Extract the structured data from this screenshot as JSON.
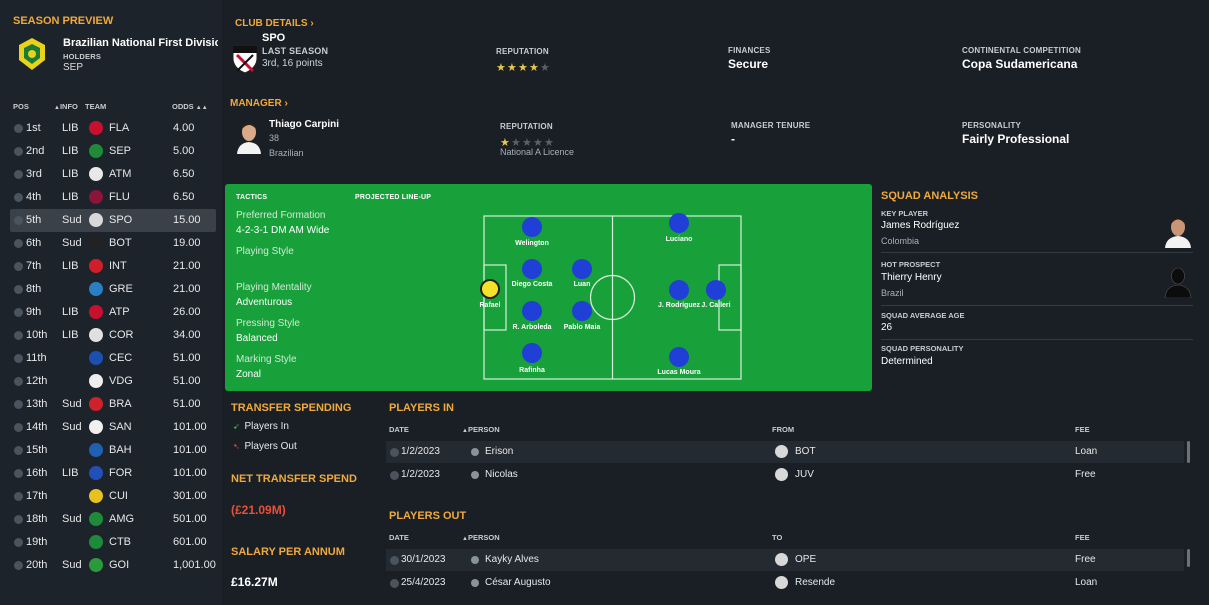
{
  "season_preview": {
    "title": "SEASON PREVIEW",
    "competition": "Brazilian National First Division",
    "holders_caption": "HOLDERS",
    "holders": "SEP"
  },
  "league_table": {
    "headers": {
      "pos": "POS",
      "info": "INFO",
      "team": "TEAM",
      "odds": "ODDS"
    },
    "rows": [
      {
        "pos": "1st",
        "info": "LIB",
        "team": "FLA",
        "odds": "4.00",
        "color": "#c8102e"
      },
      {
        "pos": "2nd",
        "info": "LIB",
        "team": "SEP",
        "odds": "5.00",
        "color": "#1f8a3a"
      },
      {
        "pos": "3rd",
        "info": "LIB",
        "team": "ATM",
        "odds": "6.50",
        "color": "#e8e8e8"
      },
      {
        "pos": "4th",
        "info": "LIB",
        "team": "FLU",
        "odds": "6.50",
        "color": "#8a1538"
      },
      {
        "pos": "5th",
        "info": "Sud",
        "team": "SPO",
        "odds": "15.00",
        "color": "#d8d8d8"
      },
      {
        "pos": "6th",
        "info": "Sud",
        "team": "BOT",
        "odds": "19.00",
        "color": "#222222"
      },
      {
        "pos": "7th",
        "info": "LIB",
        "team": "INT",
        "odds": "21.00",
        "color": "#d01e2a"
      },
      {
        "pos": "8th",
        "info": "",
        "team": "GRE",
        "odds": "21.00",
        "color": "#2a7fc4"
      },
      {
        "pos": "9th",
        "info": "LIB",
        "team": "ATP",
        "odds": "26.00",
        "color": "#c8102e"
      },
      {
        "pos": "10th",
        "info": "LIB",
        "team": "COR",
        "odds": "34.00",
        "color": "#e0e0e0"
      },
      {
        "pos": "11th",
        "info": "",
        "team": "CEC",
        "odds": "51.00",
        "color": "#1d4fb0"
      },
      {
        "pos": "12th",
        "info": "",
        "team": "VDG",
        "odds": "51.00",
        "color": "#eeeeee"
      },
      {
        "pos": "13th",
        "info": "Sud",
        "team": "BRA",
        "odds": "51.00",
        "color": "#d0202a"
      },
      {
        "pos": "14th",
        "info": "Sud",
        "team": "SAN",
        "odds": "101.00",
        "color": "#f0f0f0"
      },
      {
        "pos": "15th",
        "info": "",
        "team": "BAH",
        "odds": "101.00",
        "color": "#2060b0"
      },
      {
        "pos": "16th",
        "info": "LIB",
        "team": "FOR",
        "odds": "101.00",
        "color": "#2050b8"
      },
      {
        "pos": "17th",
        "info": "",
        "team": "CUI",
        "odds": "301.00",
        "color": "#e8c020"
      },
      {
        "pos": "18th",
        "info": "Sud",
        "team": "AMG",
        "odds": "501.00",
        "color": "#1f8a3a"
      },
      {
        "pos": "19th",
        "info": "",
        "team": "CTB",
        "odds": "601.00",
        "color": "#1f8a3a"
      },
      {
        "pos": "20th",
        "info": "Sud",
        "team": "GOI",
        "odds": "1,001.00",
        "color": "#2a9a3a"
      }
    ]
  },
  "club": {
    "link": "CLUB DETAILS",
    "name": "SPO",
    "last_season_caption": "LAST SEASON",
    "last_season": "3rd, 16 points",
    "reputation_caption": "REPUTATION",
    "reputation_stars": 4,
    "finances_caption": "FINANCES",
    "finances": "Secure",
    "continental_caption": "CONTINENTAL COMPETITION",
    "continental": "Copa Sudamericana"
  },
  "manager": {
    "link": "MANAGER",
    "name": "Thiago Carpini",
    "age": "38",
    "nationality": "Brazilian",
    "reputation_caption": "REPUTATION",
    "reputation_stars": 1,
    "licence": "National A Licence",
    "tenure_caption": "MANAGER TENURE",
    "tenure": "-",
    "personality_caption": "PERSONALITY",
    "personality": "Fairly Professional"
  },
  "tactics": {
    "caption": "TACTICS",
    "lineup_caption": "PROJECTED LINE-UP",
    "formation_label": "Preferred Formation",
    "formation": "4-2-3-1 DM AM Wide",
    "playing_style_label": "Playing Style",
    "mentality_label": "Playing Mentality",
    "mentality": "Adventurous",
    "pressing_label": "Pressing Style",
    "pressing": "Balanced",
    "marking_label": "Marking Style",
    "marking": "Zonal",
    "players": [
      {
        "name": "Rafael",
        "gk": true
      },
      {
        "name": "Welington"
      },
      {
        "name": "Diego Costa"
      },
      {
        "name": "R. Arboleda"
      },
      {
        "name": "Rafinha"
      },
      {
        "name": "Luan"
      },
      {
        "name": "Pablo Maia"
      },
      {
        "name": "Luciano"
      },
      {
        "name": "J. Rodríguez"
      },
      {
        "name": "J. Calleri"
      },
      {
        "name": "Lucas Moura"
      }
    ]
  },
  "squad_analysis": {
    "title": "SQUAD ANALYSIS",
    "key_player_caption": "KEY PLAYER",
    "key_player": "James Rodríguez",
    "key_player_nation": "Colombia",
    "hot_prospect_caption": "HOT PROSPECT",
    "hot_prospect": "Thierry Henry",
    "hot_prospect_nation": "Brazil",
    "avg_age_caption": "SQUAD AVERAGE AGE",
    "avg_age": "26",
    "personality_caption": "SQUAD PERSONALITY",
    "personality": "Determined"
  },
  "transfer_spending": {
    "title": "TRANSFER SPENDING",
    "players_in": "Players In",
    "players_out": "Players Out",
    "net_caption": "NET TRANSFER SPEND",
    "net": "(£21.09M)",
    "salary_caption": "SALARY PER ANNUM",
    "salary": "£16.27M",
    "in_color": "#3fb54a",
    "out_color": "#d8403a"
  },
  "players_in": {
    "title": "PLAYERS IN",
    "headers": {
      "date": "DATE",
      "person": "PERSON",
      "club": "FROM",
      "fee": "FEE"
    },
    "rows": [
      {
        "date": "1/2/2023",
        "person": "Erison",
        "club": "BOT",
        "fee": "Loan"
      },
      {
        "date": "1/2/2023",
        "person": "Nicolas",
        "club": "JUV",
        "fee": "Free"
      }
    ]
  },
  "players_out": {
    "title": "PLAYERS OUT",
    "headers": {
      "date": "DATE",
      "person": "PERSON",
      "club": "TO",
      "fee": "FEE"
    },
    "rows": [
      {
        "date": "30/1/2023",
        "person": "Kayky Alves",
        "club": "OPE",
        "fee": "Free"
      },
      {
        "date": "25/4/2023",
        "person": "César Augusto",
        "club": "Resende",
        "fee": "Loan"
      }
    ]
  }
}
